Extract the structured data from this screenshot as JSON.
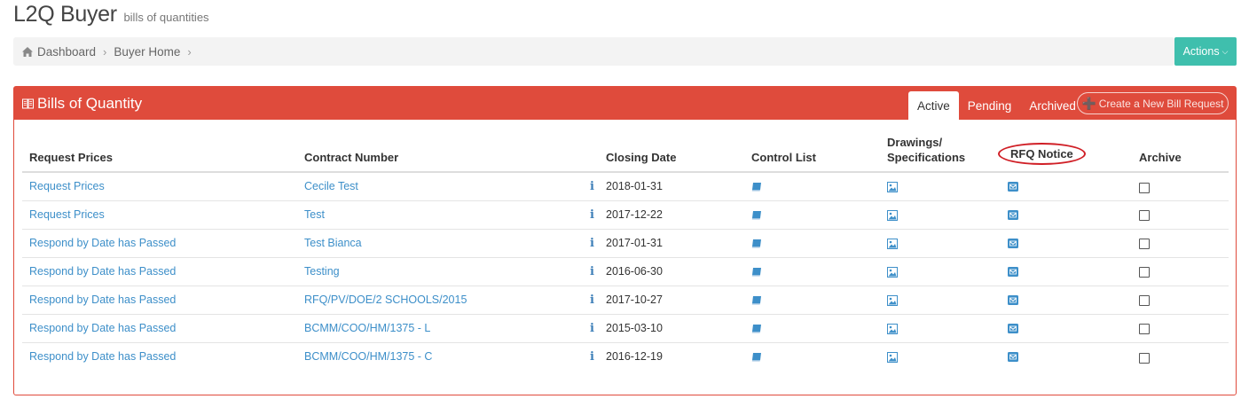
{
  "header": {
    "title": "L2Q Buyer",
    "subtitle": "bills of quantities"
  },
  "breadcrumb": {
    "items": [
      {
        "label": "Dashboard",
        "icon": "home-icon"
      },
      {
        "label": "Buyer Home"
      }
    ]
  },
  "actions": {
    "label": "Actions"
  },
  "panel": {
    "title": "Bills of Quantity",
    "icon": "book-icon",
    "tabs": [
      {
        "label": "Active",
        "active": true
      },
      {
        "label": "Pending",
        "active": false
      },
      {
        "label": "Archived",
        "active": false
      }
    ],
    "create_button": "Create a New Bill Request"
  },
  "table": {
    "columns": {
      "request_prices": "Request Prices",
      "contract_number": "Contract Number",
      "closing_date": "Closing Date",
      "control_list": "Control List",
      "drawings_line1": "Drawings/",
      "drawings_line2": "Specifications",
      "rfq_notice": "RFQ Notice",
      "archive": "Archive"
    },
    "rows": [
      {
        "request": "Request Prices",
        "contract": "Cecile Test",
        "closing": "2018-01-31",
        "archived": false
      },
      {
        "request": "Request Prices",
        "contract": "Test",
        "closing": "2017-12-22",
        "archived": false
      },
      {
        "request": "Respond by Date has Passed",
        "contract": "Test Bianca",
        "closing": "2017-01-31",
        "archived": false
      },
      {
        "request": "Respond by Date has Passed",
        "contract": "Testing",
        "closing": "2016-06-30",
        "archived": false
      },
      {
        "request": "Respond by Date has Passed",
        "contract": "RFQ/PV/DOE/2 SCHOOLS/2015",
        "closing": "2017-10-27",
        "archived": false
      },
      {
        "request": "Respond by Date has Passed",
        "contract": "BCMM/COO/HM/1375 - L",
        "closing": "2015-03-10",
        "archived": false
      },
      {
        "request": "Respond by Date has Passed",
        "contract": "BCMM/COO/HM/1375 - C",
        "closing": "2016-12-19",
        "archived": false
      }
    ],
    "info_glyph": "i"
  },
  "colors": {
    "panel_header": "#df4b3c",
    "actions_button": "#3fbfad",
    "link": "#3d8fc9",
    "highlight_ellipse": "#d01f26"
  }
}
